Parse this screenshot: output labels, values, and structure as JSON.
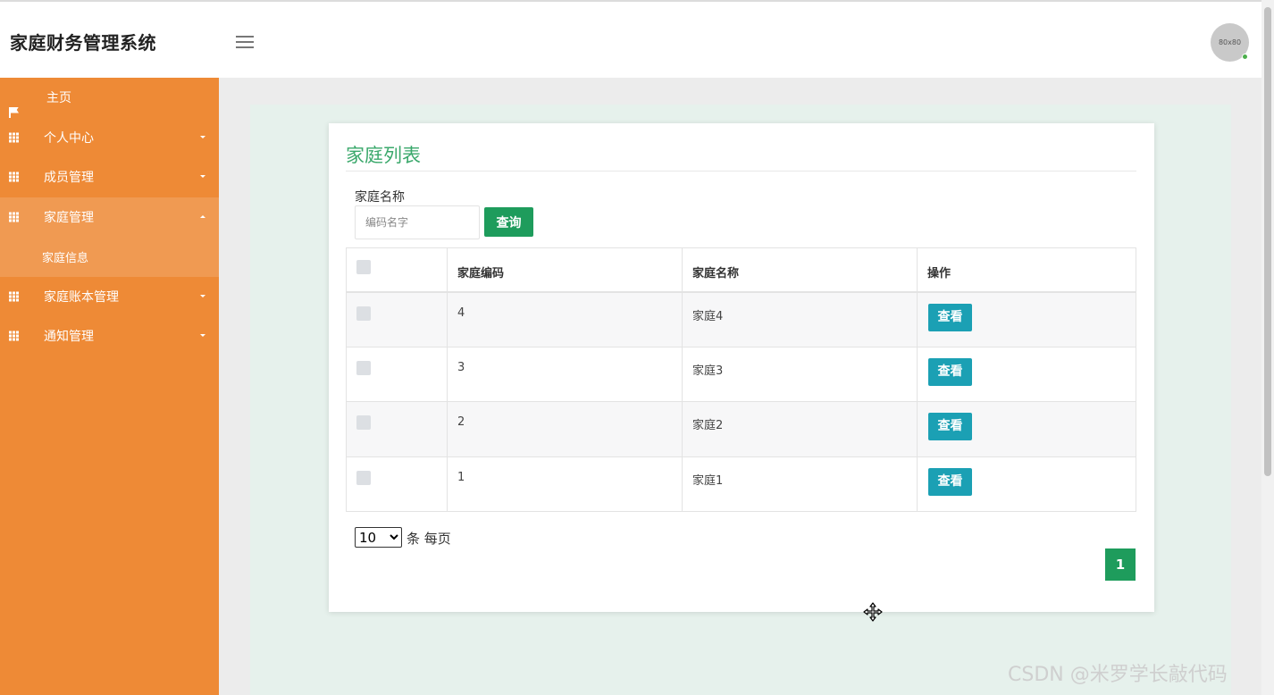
{
  "app": {
    "title": "家庭财务管理系统",
    "avatar_text": "80x80"
  },
  "sidebar": {
    "items": [
      {
        "label": "主页",
        "icon": "flag-icon"
      },
      {
        "label": "个人中心",
        "icon": "grid-icon"
      },
      {
        "label": "成员管理",
        "icon": "grid-icon"
      },
      {
        "label": "家庭管理",
        "icon": "grid-icon",
        "expanded": true
      },
      {
        "label": "家庭账本管理",
        "icon": "grid-icon"
      },
      {
        "label": "通知管理",
        "icon": "grid-icon"
      }
    ],
    "sub_items": [
      {
        "label": "家庭信息"
      }
    ]
  },
  "main": {
    "title": "家庭列表",
    "search": {
      "label": "家庭名称",
      "placeholder": "编码名字",
      "value": "",
      "button": "查询"
    },
    "table": {
      "headers": [
        "",
        "家庭编码",
        "家庭名称",
        "操作"
      ],
      "rows": [
        {
          "code": "4",
          "name": "家庭4",
          "action": "查看"
        },
        {
          "code": "3",
          "name": "家庭3",
          "action": "查看"
        },
        {
          "code": "2",
          "name": "家庭2",
          "action": "查看"
        },
        {
          "code": "1",
          "name": "家庭1",
          "action": "查看"
        }
      ]
    },
    "pagination": {
      "page_size": "10",
      "page_size_options": [
        "10"
      ],
      "page_size_label": "条 每页",
      "current_page": "1"
    }
  },
  "watermark": "CSDN @米罗学长敲代码",
  "colors": {
    "sidebar": "#ee8a36",
    "sidebar_active": "#f09a52",
    "primary_green": "#1e9c5c",
    "title_green": "#3aa86b",
    "view_button": "#1ba0b4",
    "main_bg": "#e6f1ec"
  }
}
